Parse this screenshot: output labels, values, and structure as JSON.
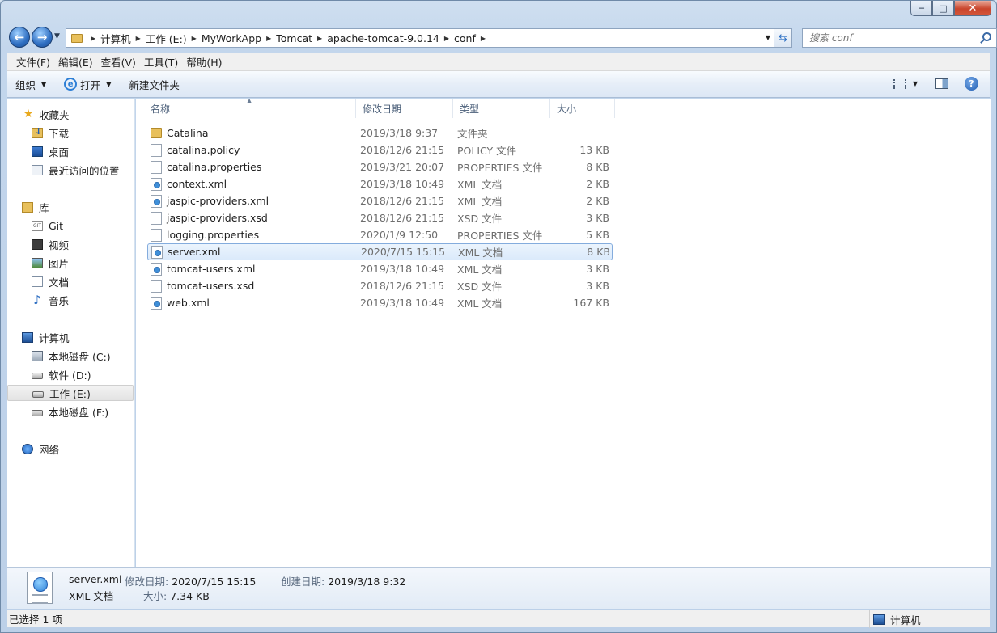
{
  "window": {
    "caption": {
      "minimize": "─",
      "maximize": "□",
      "close": "✕"
    }
  },
  "nav": {
    "back": "←",
    "forward": "→",
    "breadcrumb": [
      "计算机",
      "工作 (E:)",
      "MyWorkApp",
      "Tomcat",
      "apache-tomcat-9.0.14",
      "conf"
    ],
    "search_placeholder": "搜索 conf"
  },
  "menu": [
    "文件(F)",
    "编辑(E)",
    "查看(V)",
    "工具(T)",
    "帮助(H)"
  ],
  "toolbar": {
    "organize": "组织",
    "open": "打开",
    "new_folder": "新建文件夹",
    "help": "?"
  },
  "sidebar": {
    "favorites": {
      "label": "收藏夹",
      "items": [
        "下载",
        "桌面",
        "最近访问的位置"
      ]
    },
    "libraries": {
      "label": "库",
      "items": [
        "Git",
        "视频",
        "图片",
        "文档",
        "音乐"
      ]
    },
    "computer": {
      "label": "计算机",
      "items": [
        "本地磁盘 (C:)",
        "软件 (D:)",
        "工作 (E:)",
        "本地磁盘 (F:)"
      ],
      "selected": "工作 (E:)"
    },
    "network": {
      "label": "网络"
    }
  },
  "columns": [
    "名称",
    "修改日期",
    "类型",
    "大小"
  ],
  "files": [
    {
      "name": "Catalina",
      "date": "2019/3/18 9:37",
      "type": "文件夹",
      "size": "",
      "icon": "folder"
    },
    {
      "name": "catalina.policy",
      "date": "2018/12/6 21:15",
      "type": "POLICY 文件",
      "size": "13 KB",
      "icon": "file"
    },
    {
      "name": "catalina.properties",
      "date": "2019/3/21 20:07",
      "type": "PROPERTIES 文件",
      "size": "8 KB",
      "icon": "file"
    },
    {
      "name": "context.xml",
      "date": "2019/3/18 10:49",
      "type": "XML 文档",
      "size": "2 KB",
      "icon": "xml"
    },
    {
      "name": "jaspic-providers.xml",
      "date": "2018/12/6 21:15",
      "type": "XML 文档",
      "size": "2 KB",
      "icon": "xml"
    },
    {
      "name": "jaspic-providers.xsd",
      "date": "2018/12/6 21:15",
      "type": "XSD 文件",
      "size": "3 KB",
      "icon": "file"
    },
    {
      "name": "logging.properties",
      "date": "2020/1/9 12:50",
      "type": "PROPERTIES 文件",
      "size": "5 KB",
      "icon": "file"
    },
    {
      "name": "server.xml",
      "date": "2020/7/15 15:15",
      "type": "XML 文档",
      "size": "8 KB",
      "icon": "xml",
      "selected": true
    },
    {
      "name": "tomcat-users.xml",
      "date": "2019/3/18 10:49",
      "type": "XML 文档",
      "size": "3 KB",
      "icon": "xml"
    },
    {
      "name": "tomcat-users.xsd",
      "date": "2018/12/6 21:15",
      "type": "XSD 文件",
      "size": "3 KB",
      "icon": "file"
    },
    {
      "name": "web.xml",
      "date": "2019/3/18 10:49",
      "type": "XML 文档",
      "size": "167 KB",
      "icon": "xml"
    }
  ],
  "details": {
    "name": "server.xml",
    "type": "XML 文档",
    "modified_label": "修改日期:",
    "modified": "2020/7/15 15:15",
    "created_label": "创建日期:",
    "created": "2019/3/18 9:32",
    "size_label": "大小:",
    "size": "7.34 KB"
  },
  "status": {
    "left": "已选择 1 项",
    "right": "计算机"
  },
  "colors": {
    "selection_fill": "#dbeafb",
    "selection_border": "#84acdd",
    "window_frame": "#c3d6ec"
  }
}
